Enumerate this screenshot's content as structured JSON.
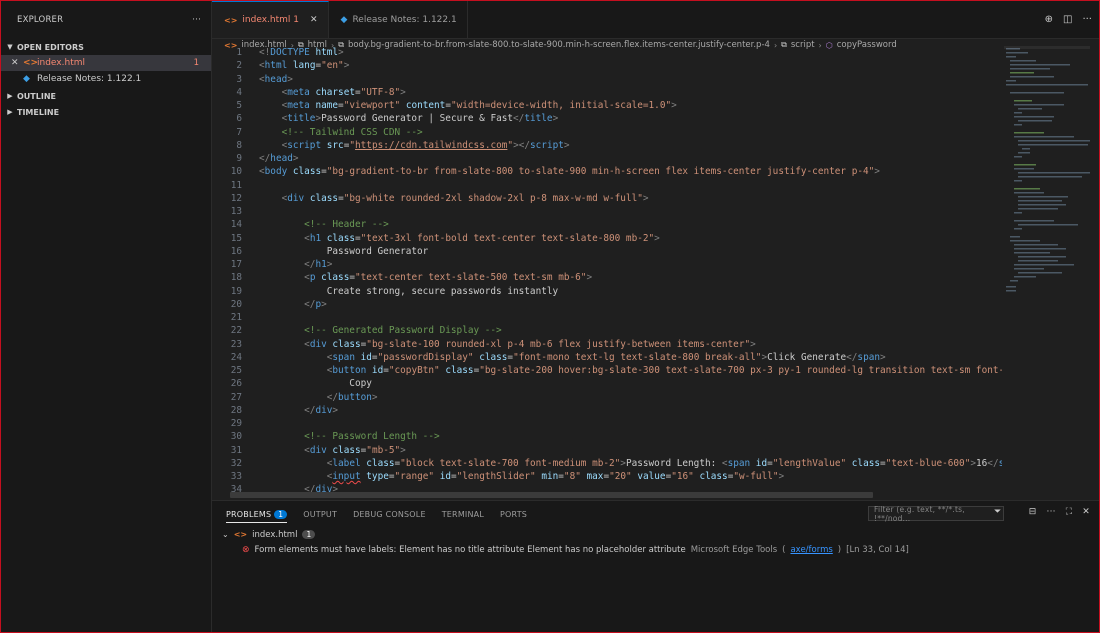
{
  "explorer": {
    "title": "EXPLORER",
    "more": "···",
    "open_editors": "OPEN EDITORS",
    "items": [
      {
        "name": "index.html",
        "badge": "1"
      },
      {
        "name": "Release Notes: 1.122.1"
      }
    ],
    "outline": "OUTLINE",
    "timeline": "TIMELINE"
  },
  "tabs": [
    {
      "label": "index.html 1"
    },
    {
      "label": "Release Notes: 1.122.1"
    }
  ],
  "breadcrumb": [
    "index.html",
    "html",
    "body.bg-gradient-to-br.from-slate-800.to-slate-900.min-h-screen.flex.items-center.justify-center.p-4",
    "script",
    "copyPassword"
  ],
  "code_lines": [
    "1",
    "2",
    "3",
    "4",
    "5",
    "6",
    "7",
    "8",
    "9",
    "10",
    "11",
    "12",
    "13",
    "14",
    "15",
    "16",
    "17",
    "18",
    "19",
    "20",
    "21",
    "22",
    "23",
    "24",
    "25",
    "26",
    "27",
    "28",
    "29",
    "30",
    "31",
    "32",
    "33",
    "34"
  ],
  "panel": {
    "tabs": [
      "PROBLEMS",
      "OUTPUT",
      "DEBUG CONSOLE",
      "TERMINAL",
      "PORTS"
    ],
    "problems_count": "1",
    "filter_placeholder": "Filter (e.g. text, **/*.ts, !**/nod...",
    "file": "index.html",
    "file_count": "1",
    "message": "Form elements must have labels: Element has no title attribute Element has no placeholder attribute",
    "source": "Microsoft Edge Tools",
    "rule": "axe/forms",
    "location": "[Ln 33, Col 14]"
  },
  "colors": {
    "accent": "#0078d4",
    "error": "#f14c4c",
    "modified": "#f48771"
  }
}
